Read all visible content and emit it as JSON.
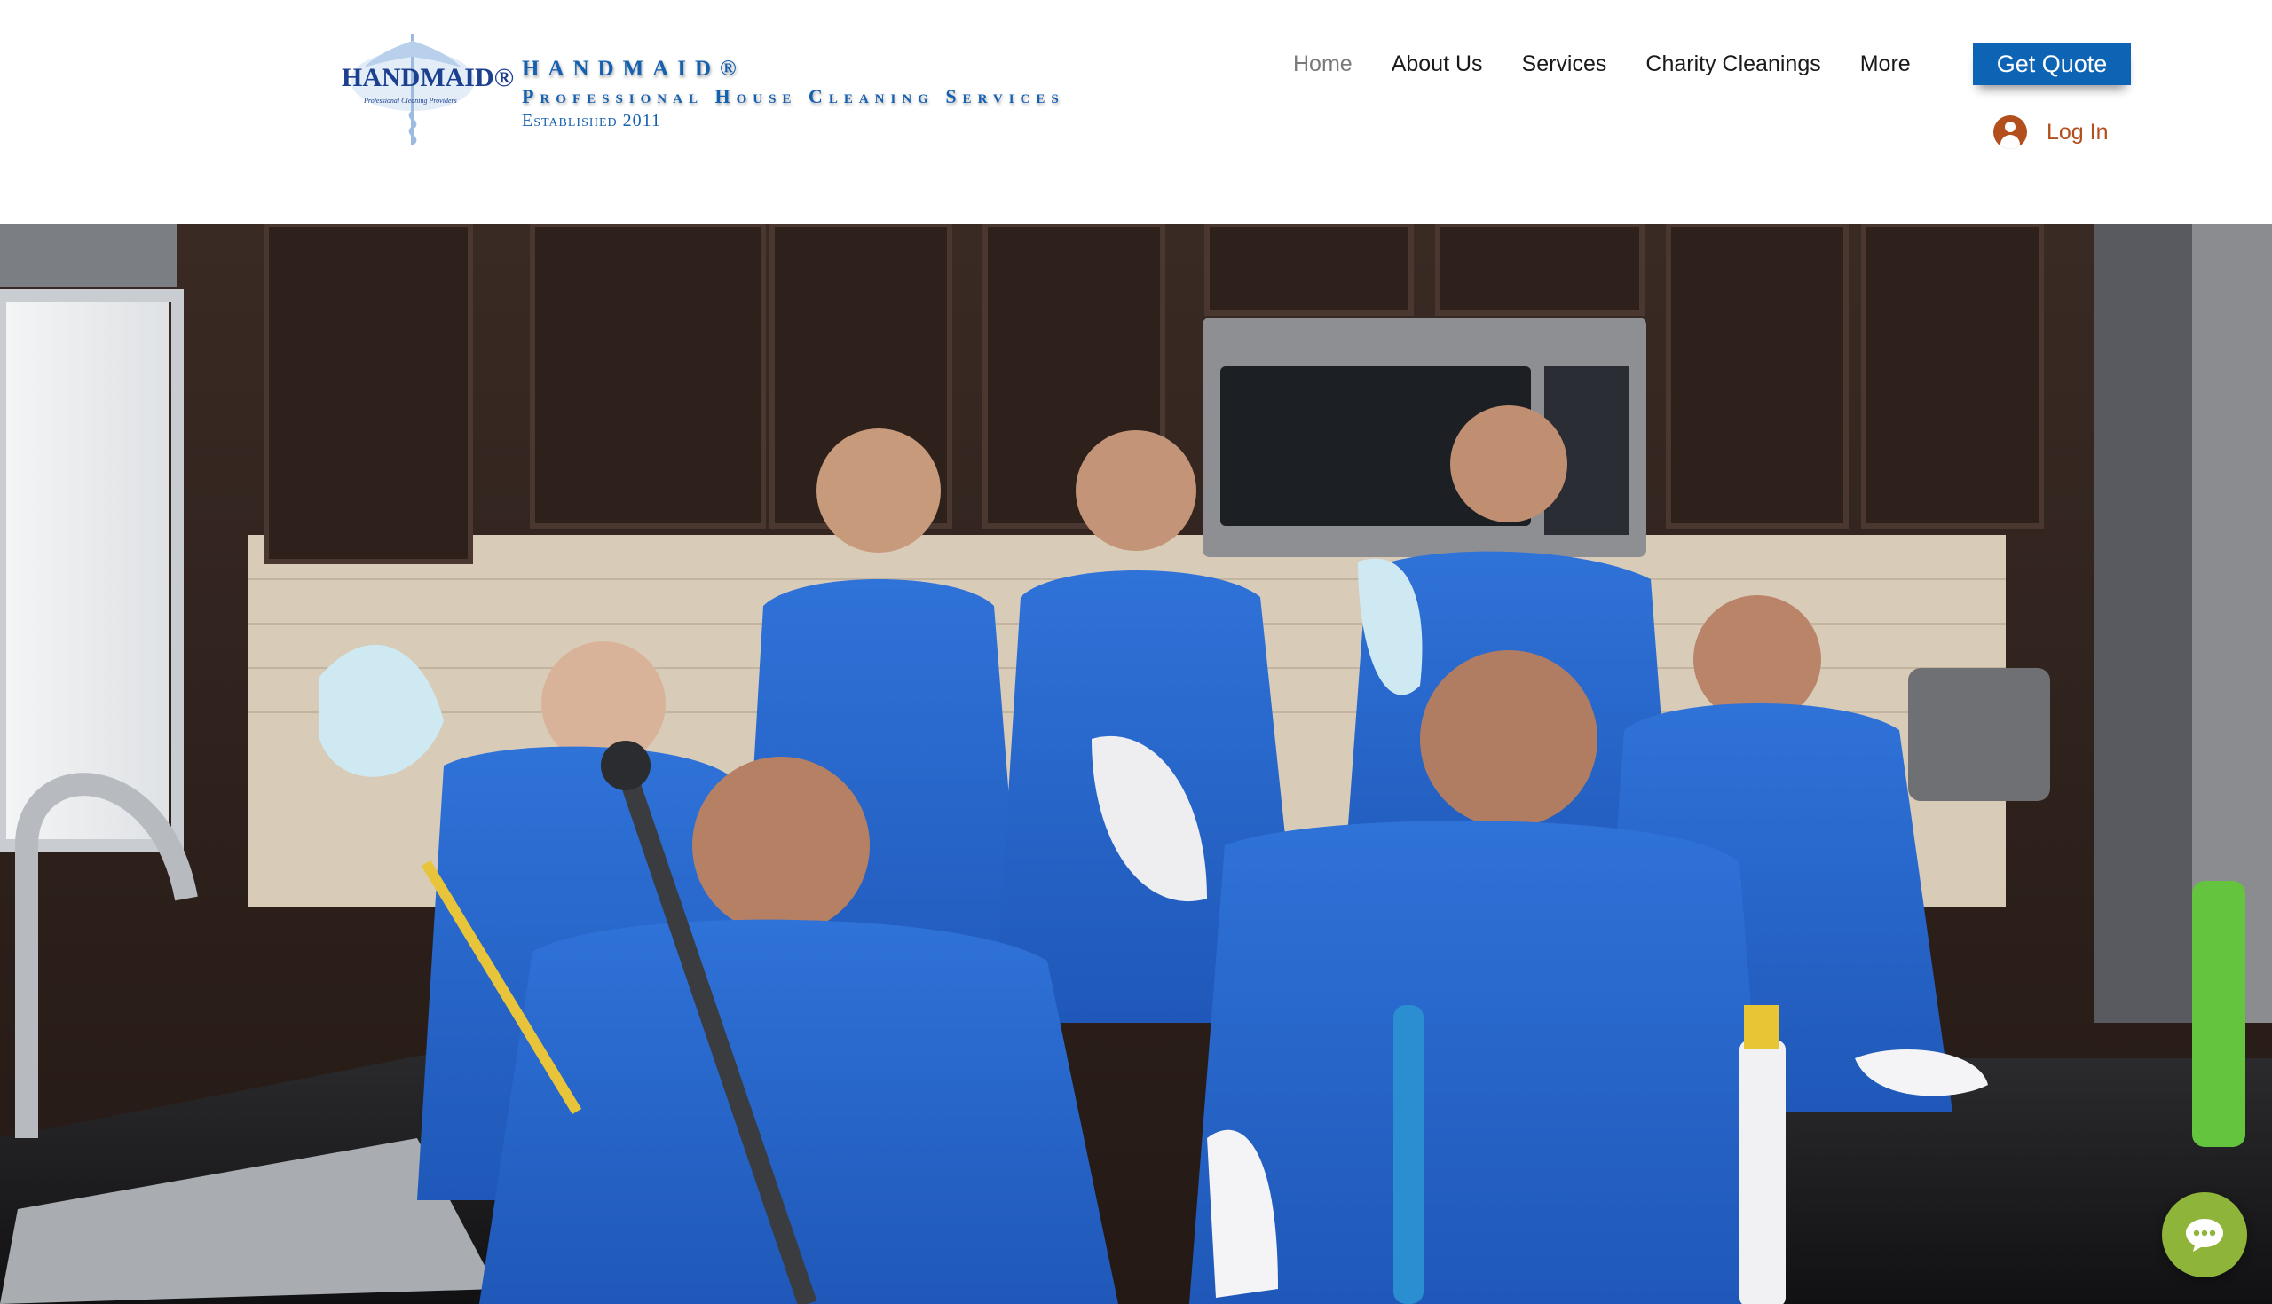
{
  "brand": {
    "logo_wordmark": "HANDMAID®",
    "logo_tagline": "Professional Cleaning Providers",
    "name": "HANDMAID®",
    "subtitle": "Professional House Cleaning Services",
    "established": "Established 2011",
    "color": "#1660b0"
  },
  "nav": {
    "items": [
      {
        "label": "Home",
        "active": true
      },
      {
        "label": "About Us",
        "active": false
      },
      {
        "label": "Services",
        "active": false
      },
      {
        "label": "Charity Cleanings",
        "active": false
      },
      {
        "label": "More",
        "active": false
      }
    ]
  },
  "actions": {
    "quote_label": "Get Quote",
    "quote_color": "#0e64b4",
    "login_label": "Log In",
    "login_color": "#b34e1d"
  },
  "hero": {
    "image_alt": "Team of cleaners in blue scrubs standing in a kitchen holding cleaning supplies"
  },
  "chat": {
    "icon": "chat-bubble-icon",
    "color": "#8fb43a"
  }
}
